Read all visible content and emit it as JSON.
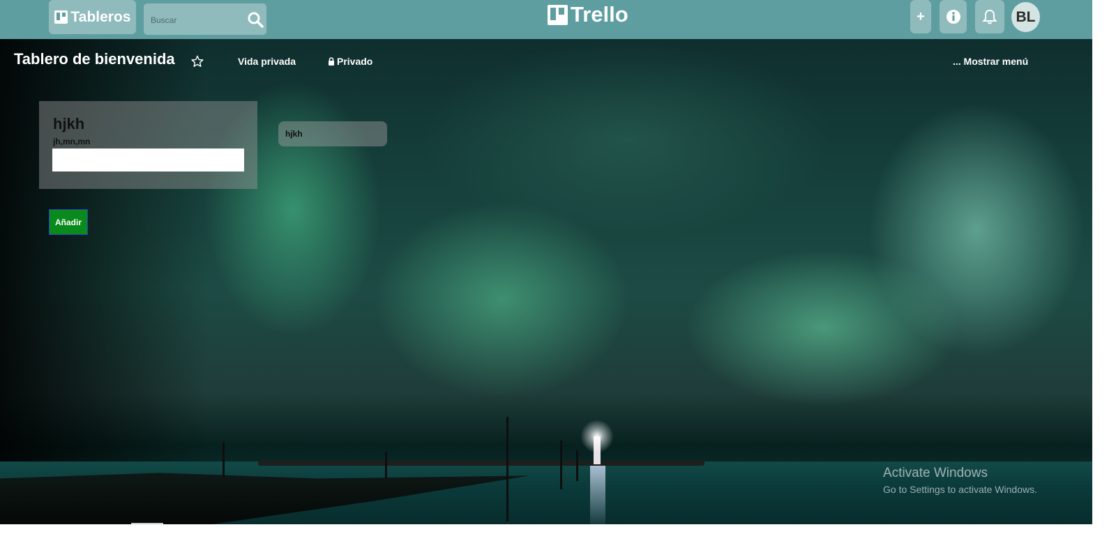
{
  "header": {
    "boards_label": "Tableros",
    "search_placeholder": "Buscar",
    "logo_text": "Trello",
    "add_label": "+",
    "avatar_initials": "BL"
  },
  "board": {
    "title": "Tablero de bienvenida",
    "visibility_team": "Vida privada",
    "visibility_private": "Privado",
    "menu_label": "... Mostrar menú"
  },
  "list": {
    "title": "hjkh",
    "subtitle": "jh,mn,mn",
    "input_value": "",
    "add_button": "Añadir"
  },
  "card_preview": "hjkh",
  "watermark": {
    "title": "Activate Windows",
    "subtitle": "Go to Settings to activate Windows."
  },
  "colors": {
    "topbar": "#5f9ea0",
    "add_button": "#0a8a1c"
  }
}
